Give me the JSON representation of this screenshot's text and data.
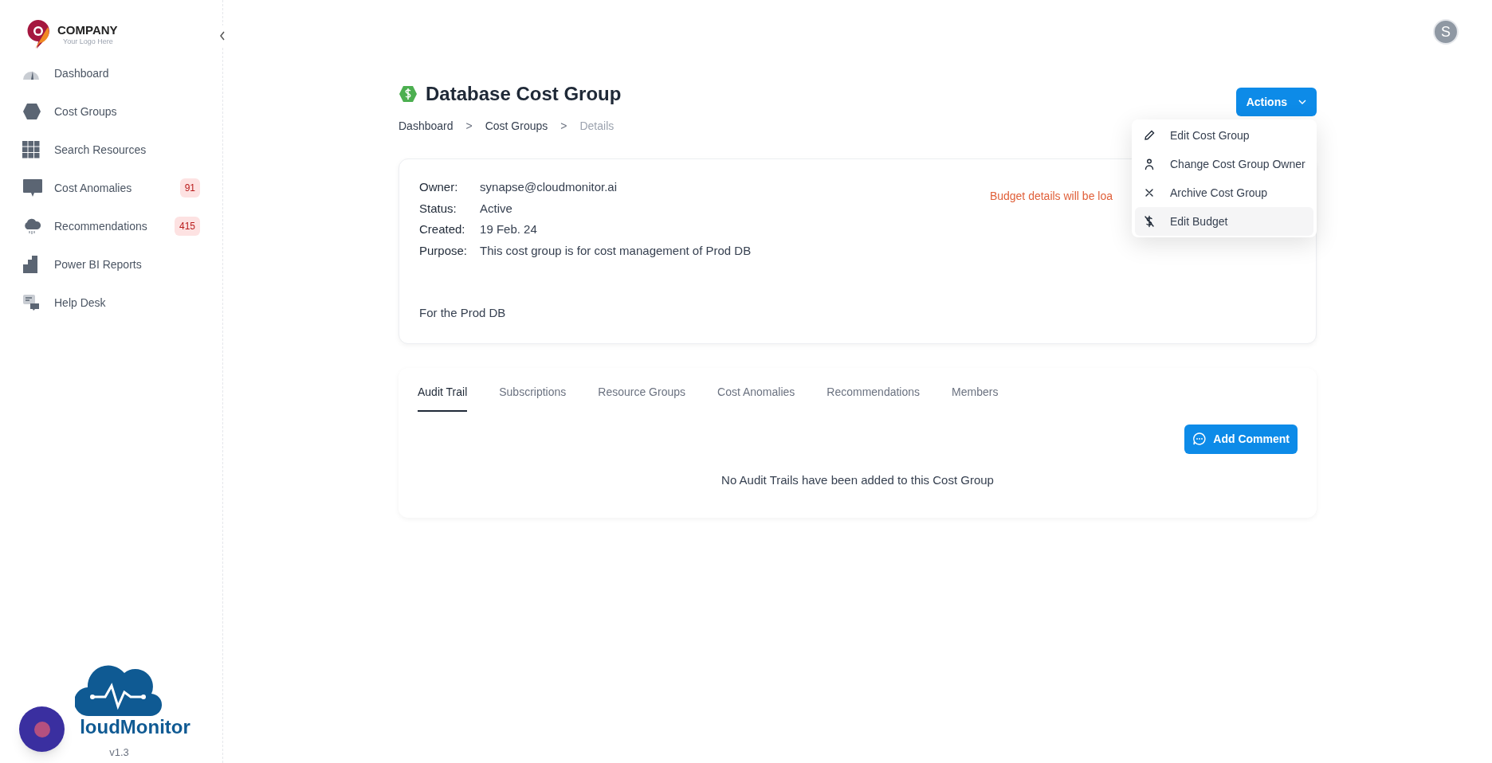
{
  "brand": {
    "name": "COMPANY",
    "tagline": "Your Logo Here"
  },
  "sidebar": {
    "items": [
      {
        "kind": "gauge",
        "label": "Dashboard",
        "selected": false
      },
      {
        "kind": "hexagon",
        "label": "Cost Groups",
        "selected": false
      },
      {
        "kind": "grid",
        "label": "Search Resources",
        "selected": false
      },
      {
        "kind": "chat",
        "label": "Cost Anomalies",
        "badge": "91",
        "selected": false
      },
      {
        "kind": "cloud",
        "label": "Recommendations",
        "badge": "415",
        "selected": false
      },
      {
        "kind": "steps",
        "label": "Power BI Reports",
        "selected": false
      },
      {
        "kind": "help",
        "label": "Help Desk",
        "selected": false
      }
    ],
    "product": "loudMonitor",
    "version": "v1.3"
  },
  "user": {
    "initial": "S"
  },
  "page": {
    "title": "Database Cost Group",
    "breadcrumb": [
      {
        "label": "Dashboard",
        "current": false
      },
      {
        "label": "Cost Groups",
        "current": false
      },
      {
        "label": "Details",
        "current": true
      }
    ],
    "separator": ">"
  },
  "actions": {
    "label": "Actions",
    "expanded": true,
    "menu": [
      {
        "kind": "pencil",
        "label": "Edit Cost Group",
        "highlighted": false
      },
      {
        "kind": "person",
        "label": "Change Cost Group Owner",
        "highlighted": false
      },
      {
        "kind": "x",
        "label": "Archive Cost Group",
        "highlighted": false
      },
      {
        "kind": "nodollar",
        "label": "Edit Budget",
        "highlighted": true
      }
    ]
  },
  "details": {
    "fields": [
      {
        "label": "Owner:",
        "value": "synapse@cloudmonitor.ai"
      },
      {
        "label": "Status:",
        "value": "Active"
      },
      {
        "label": "Created:",
        "value": "19 Feb. 24"
      },
      {
        "label": "Purpose:",
        "value": "This cost group is for cost management of Prod DB"
      }
    ],
    "budget_note": "Budget details will be loa",
    "description": "For the Prod DB"
  },
  "tabs": [
    {
      "label": "Audit Trail",
      "selected": true
    },
    {
      "label": "Subscriptions",
      "selected": false
    },
    {
      "label": "Resource Groups",
      "selected": false
    },
    {
      "label": "Cost Anomalies",
      "selected": false
    },
    {
      "label": "Recommendations",
      "selected": false
    },
    {
      "label": "Members",
      "selected": false
    }
  ],
  "audit": {
    "button": "Add Comment",
    "empty_message": "No Audit Trails have been added to this Cost Group"
  }
}
